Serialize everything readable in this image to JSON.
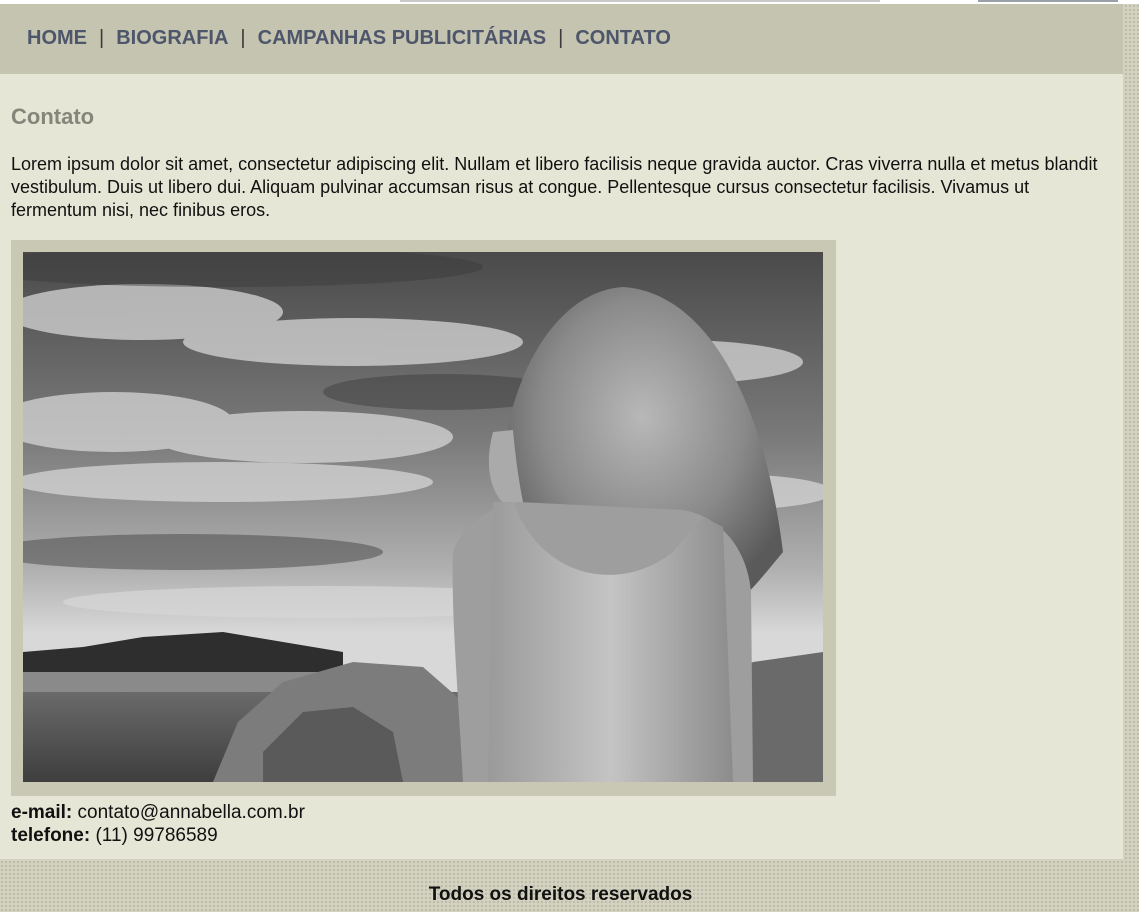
{
  "nav": {
    "items": [
      {
        "label": "HOME"
      },
      {
        "label": "BIOGRAFIA"
      },
      {
        "label": "CAMPANHAS PUBLICITÁRIAS"
      },
      {
        "label": "CONTATO"
      }
    ],
    "separator": "|"
  },
  "page": {
    "title": "Contato",
    "intro": "Lorem ipsum dolor sit amet, consectetur adipiscing elit. Nullam et libero facilisis neque gravida auctor. Cras viverra nulla et metus blandit vestibulum. Duis ut libero dui. Aliquam pulvinar accumsan risus at congue. Pellentesque cursus consectetur facilisis. Vivamus ut fermentum nisi, nec finibus eros."
  },
  "contact": {
    "email_label": "e-mail:",
    "email_value": "contato@annabella.com.br",
    "phone_label": "telefone:",
    "phone_value": "(11) 99786589"
  },
  "footer": {
    "text": "Todos os direitos reservados"
  },
  "colors": {
    "navbar_bg": "#c5c4b0",
    "content_bg": "#e6e6d6",
    "nav_text": "#4d566a",
    "title_text": "#85857a",
    "photo_frame": "#c8c8b4"
  }
}
